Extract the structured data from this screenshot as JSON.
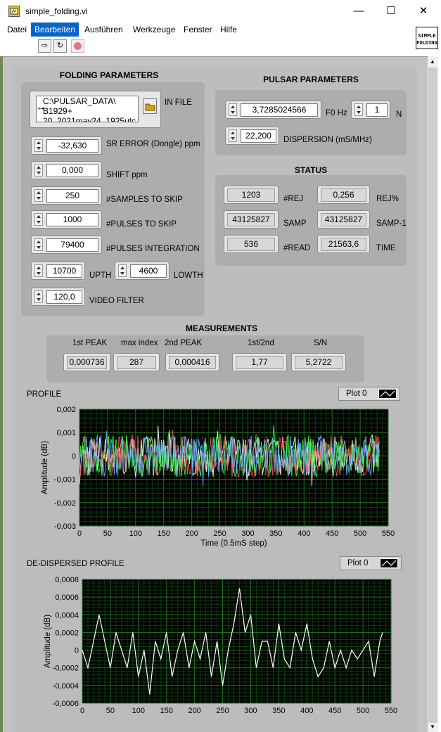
{
  "window": {
    "title": "simple_folding.vi",
    "minimize": "—",
    "maximize": "☐",
    "close": "✕"
  },
  "menu": [
    "Datei",
    "Bearbeiten",
    "Ausführen",
    "Werkzeuge",
    "Fenster",
    "Hilfe"
  ],
  "logo": {
    "line1": "SIMPLE",
    "line2": "FOLDING"
  },
  "folding": {
    "title": "FOLDING PARAMETERS",
    "in_file": {
      "path_lines": [
        "C:\\PULSAR_DATA\\",
        "B1929+",
        "20_2021may24_1925utc"
      ],
      "label": "IN FILE"
    },
    "sr_error": {
      "value": "-32,630",
      "label": "SR ERROR (Dongle) ppm"
    },
    "shift": {
      "value": "0,000",
      "label": "SHIFT ppm"
    },
    "samples_skip": {
      "value": "250",
      "label": "#SAMPLES TO SKIP"
    },
    "pulses_skip": {
      "value": "1000",
      "label": "#PULSES TO SKIP"
    },
    "pulses_integration": {
      "value": "79400",
      "label": "#PULSES INTEGRATION"
    },
    "upth": {
      "value": "10700",
      "label": "UPTH"
    },
    "lowth": {
      "value": "4600",
      "label": "LOWTH"
    },
    "video_filter": {
      "value": "120,0",
      "label": "VIDEO FILTER"
    }
  },
  "pulsar": {
    "title": "PULSAR PARAMETERS",
    "f0": {
      "value": "3,7285024566",
      "label": "F0 Hz"
    },
    "n": {
      "value": "1",
      "label": "N"
    },
    "dispersion": {
      "value": "22,200",
      "label": "DISPERSION (mS/MHz)"
    }
  },
  "status": {
    "title": "STATUS",
    "rej": {
      "value": "1203",
      "label": "#REJ"
    },
    "rej_pct": {
      "value": "0,256",
      "label": "REJ%"
    },
    "samp": {
      "value": "43125827",
      "label": "SAMP"
    },
    "samp1": {
      "value": "43125827",
      "label": "SAMP-1"
    },
    "read": {
      "value": "536",
      "label": "#READ"
    },
    "time": {
      "value": "21563,6",
      "label": "TIME"
    }
  },
  "measurements": {
    "title": "MEASUREMENTS",
    "peak1": {
      "label": "1st PEAK",
      "value": "0,000736"
    },
    "max_index": {
      "label": "max index",
      "value": "287"
    },
    "peak2": {
      "label": "2nd PEAK",
      "value": "0,000416"
    },
    "ratio": {
      "label": "1st/2nd",
      "value": "1,77"
    },
    "sn": {
      "label": "S/N",
      "value": "5,2722"
    }
  },
  "profile": {
    "title": "PROFILE",
    "legend": "Plot 0"
  },
  "dedispersed": {
    "title": "DE-DISPERSED PROFILE",
    "legend": "Plot 0"
  },
  "chart_data": [
    {
      "type": "line",
      "xlabel": "Time (0.5mS step)",
      "ylabel": "Amplitude (dB)",
      "xlim": [
        0,
        550
      ],
      "ylim": [
        -0.003,
        0.002
      ],
      "xticks": [
        "0",
        "50",
        "100",
        "150",
        "200",
        "250",
        "300",
        "350",
        "400",
        "450",
        "500",
        "550"
      ],
      "yticks": [
        "0,002",
        "0,001",
        "0",
        "-0,001",
        "-0,002",
        "-0,003"
      ],
      "background": "#000000",
      "grid": true,
      "series_colors": [
        "#ffffff",
        "#ff4d4d",
        "#33ff33",
        "#66b3ff"
      ],
      "x_range_data": [
        0,
        535
      ],
      "amplitude_envelope": [
        -0.002,
        0.0016
      ]
    },
    {
      "type": "line",
      "xlabel": "",
      "ylabel": "Amplitude (dB)",
      "xlim": [
        0,
        550
      ],
      "ylim": [
        -0.0006,
        0.0008
      ],
      "xticks": [
        "0",
        "50",
        "100",
        "150",
        "200",
        "250",
        "300",
        "350",
        "400",
        "450",
        "500",
        "550"
      ],
      "yticks": [
        "0,0008",
        "0,0006",
        "0,0004",
        "0,0002",
        "0",
        "-0,0002",
        "-0,0004",
        "-0,0006"
      ],
      "background": "#000000",
      "grid": true,
      "series_colors": [
        "#ffffff"
      ],
      "x": [
        0,
        10,
        20,
        30,
        40,
        50,
        60,
        70,
        80,
        90,
        100,
        110,
        120,
        130,
        140,
        150,
        160,
        170,
        180,
        190,
        200,
        210,
        220,
        230,
        240,
        250,
        260,
        270,
        280,
        290,
        300,
        310,
        320,
        330,
        340,
        350,
        360,
        370,
        380,
        390,
        400,
        410,
        420,
        430,
        440,
        450,
        460,
        470,
        480,
        490,
        500,
        510,
        520,
        530,
        535
      ],
      "y": [
        0.0,
        -0.0002,
        0.0001,
        0.0004,
        0.0001,
        -0.0002,
        0.0002,
        0.0,
        -0.0002,
        0.0002,
        -0.0003,
        0.0,
        -0.0005,
        0.0001,
        -0.0001,
        0.0002,
        -0.0003,
        0.0,
        0.0002,
        -0.0002,
        0.0001,
        -0.0001,
        0.0002,
        -0.0003,
        0.0001,
        -0.0004,
        0.0,
        0.0003,
        0.0007,
        0.0002,
        0.0004,
        -0.0002,
        0.0001,
        0.0001,
        -0.0002,
        0.0003,
        -0.0001,
        -0.0002,
        0.0002,
        0.0,
        0.0003,
        -0.0001,
        -0.0003,
        -0.0002,
        0.0001,
        -0.0002,
        0.0,
        -0.0002,
        0.0,
        -0.0001,
        0.0,
        0.0001,
        -0.0003,
        0.0001,
        0.0002
      ]
    }
  ]
}
